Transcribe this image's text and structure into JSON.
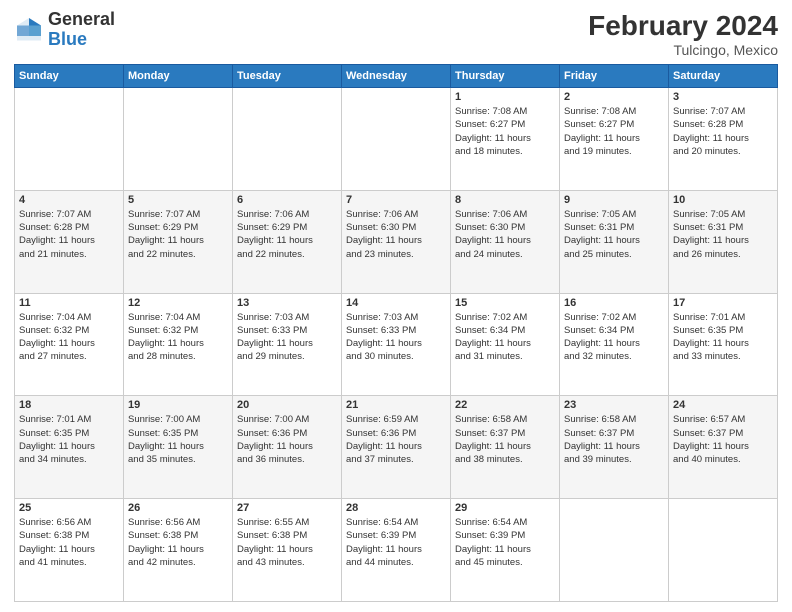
{
  "header": {
    "logo_line1": "General",
    "logo_line2": "Blue",
    "month_year": "February 2024",
    "location": "Tulcingo, Mexico"
  },
  "days_of_week": [
    "Sunday",
    "Monday",
    "Tuesday",
    "Wednesday",
    "Thursday",
    "Friday",
    "Saturday"
  ],
  "weeks": [
    [
      {
        "date": "",
        "info": ""
      },
      {
        "date": "",
        "info": ""
      },
      {
        "date": "",
        "info": ""
      },
      {
        "date": "",
        "info": ""
      },
      {
        "date": "1",
        "info": "Sunrise: 7:08 AM\nSunset: 6:27 PM\nDaylight: 11 hours\nand 18 minutes."
      },
      {
        "date": "2",
        "info": "Sunrise: 7:08 AM\nSunset: 6:27 PM\nDaylight: 11 hours\nand 19 minutes."
      },
      {
        "date": "3",
        "info": "Sunrise: 7:07 AM\nSunset: 6:28 PM\nDaylight: 11 hours\nand 20 minutes."
      }
    ],
    [
      {
        "date": "4",
        "info": "Sunrise: 7:07 AM\nSunset: 6:28 PM\nDaylight: 11 hours\nand 21 minutes."
      },
      {
        "date": "5",
        "info": "Sunrise: 7:07 AM\nSunset: 6:29 PM\nDaylight: 11 hours\nand 22 minutes."
      },
      {
        "date": "6",
        "info": "Sunrise: 7:06 AM\nSunset: 6:29 PM\nDaylight: 11 hours\nand 22 minutes."
      },
      {
        "date": "7",
        "info": "Sunrise: 7:06 AM\nSunset: 6:30 PM\nDaylight: 11 hours\nand 23 minutes."
      },
      {
        "date": "8",
        "info": "Sunrise: 7:06 AM\nSunset: 6:30 PM\nDaylight: 11 hours\nand 24 minutes."
      },
      {
        "date": "9",
        "info": "Sunrise: 7:05 AM\nSunset: 6:31 PM\nDaylight: 11 hours\nand 25 minutes."
      },
      {
        "date": "10",
        "info": "Sunrise: 7:05 AM\nSunset: 6:31 PM\nDaylight: 11 hours\nand 26 minutes."
      }
    ],
    [
      {
        "date": "11",
        "info": "Sunrise: 7:04 AM\nSunset: 6:32 PM\nDaylight: 11 hours\nand 27 minutes."
      },
      {
        "date": "12",
        "info": "Sunrise: 7:04 AM\nSunset: 6:32 PM\nDaylight: 11 hours\nand 28 minutes."
      },
      {
        "date": "13",
        "info": "Sunrise: 7:03 AM\nSunset: 6:33 PM\nDaylight: 11 hours\nand 29 minutes."
      },
      {
        "date": "14",
        "info": "Sunrise: 7:03 AM\nSunset: 6:33 PM\nDaylight: 11 hours\nand 30 minutes."
      },
      {
        "date": "15",
        "info": "Sunrise: 7:02 AM\nSunset: 6:34 PM\nDaylight: 11 hours\nand 31 minutes."
      },
      {
        "date": "16",
        "info": "Sunrise: 7:02 AM\nSunset: 6:34 PM\nDaylight: 11 hours\nand 32 minutes."
      },
      {
        "date": "17",
        "info": "Sunrise: 7:01 AM\nSunset: 6:35 PM\nDaylight: 11 hours\nand 33 minutes."
      }
    ],
    [
      {
        "date": "18",
        "info": "Sunrise: 7:01 AM\nSunset: 6:35 PM\nDaylight: 11 hours\nand 34 minutes."
      },
      {
        "date": "19",
        "info": "Sunrise: 7:00 AM\nSunset: 6:35 PM\nDaylight: 11 hours\nand 35 minutes."
      },
      {
        "date": "20",
        "info": "Sunrise: 7:00 AM\nSunset: 6:36 PM\nDaylight: 11 hours\nand 36 minutes."
      },
      {
        "date": "21",
        "info": "Sunrise: 6:59 AM\nSunset: 6:36 PM\nDaylight: 11 hours\nand 37 minutes."
      },
      {
        "date": "22",
        "info": "Sunrise: 6:58 AM\nSunset: 6:37 PM\nDaylight: 11 hours\nand 38 minutes."
      },
      {
        "date": "23",
        "info": "Sunrise: 6:58 AM\nSunset: 6:37 PM\nDaylight: 11 hours\nand 39 minutes."
      },
      {
        "date": "24",
        "info": "Sunrise: 6:57 AM\nSunset: 6:37 PM\nDaylight: 11 hours\nand 40 minutes."
      }
    ],
    [
      {
        "date": "25",
        "info": "Sunrise: 6:56 AM\nSunset: 6:38 PM\nDaylight: 11 hours\nand 41 minutes."
      },
      {
        "date": "26",
        "info": "Sunrise: 6:56 AM\nSunset: 6:38 PM\nDaylight: 11 hours\nand 42 minutes."
      },
      {
        "date": "27",
        "info": "Sunrise: 6:55 AM\nSunset: 6:38 PM\nDaylight: 11 hours\nand 43 minutes."
      },
      {
        "date": "28",
        "info": "Sunrise: 6:54 AM\nSunset: 6:39 PM\nDaylight: 11 hours\nand 44 minutes."
      },
      {
        "date": "29",
        "info": "Sunrise: 6:54 AM\nSunset: 6:39 PM\nDaylight: 11 hours\nand 45 minutes."
      },
      {
        "date": "",
        "info": ""
      },
      {
        "date": "",
        "info": ""
      }
    ]
  ]
}
